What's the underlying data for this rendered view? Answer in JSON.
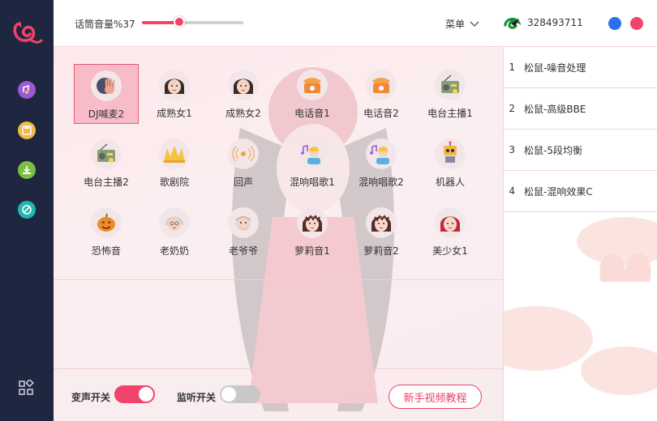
{
  "topbar": {
    "volume_label": "话筒音量%37",
    "volume_percent": 37,
    "menu_label": "菜单",
    "qq_number": "328493711",
    "window_buttons": [
      {
        "name": "minimize-dot",
        "color": "#2b6ff0"
      },
      {
        "name": "close-dot",
        "color": "#f2446a"
      }
    ]
  },
  "sidebar": {
    "items": [
      {
        "name": "sidebar-item-effects",
        "icon": "voice-icon",
        "color": "#9b59d6"
      },
      {
        "name": "sidebar-item-save",
        "icon": "disk-icon",
        "color": "#f5b64a"
      },
      {
        "name": "sidebar-item-download",
        "icon": "download-icon",
        "color": "#7bc043"
      },
      {
        "name": "sidebar-item-tools",
        "icon": "no-entry-icon",
        "color": "#22b6b0"
      }
    ],
    "bottom_icon": "grid-icon"
  },
  "effects": [
    {
      "label": "DJ喊麦2",
      "icon": "dj-hand-icon",
      "selected": true
    },
    {
      "label": "成熟女1",
      "icon": "woman-avatar-icon"
    },
    {
      "label": "成熟女2",
      "icon": "woman-avatar-icon"
    },
    {
      "label": "电话音1",
      "icon": "telephone-icon"
    },
    {
      "label": "电话音2",
      "icon": "telephone-icon"
    },
    {
      "label": "电台主播1",
      "icon": "radio-icon"
    },
    {
      "label": "电台主播2",
      "icon": "radio-icon"
    },
    {
      "label": "歌剧院",
      "icon": "opera-house-icon"
    },
    {
      "label": "回声",
      "icon": "echo-icon"
    },
    {
      "label": "混响唱歌1",
      "icon": "singer-icon"
    },
    {
      "label": "混响唱歌2",
      "icon": "singer-icon"
    },
    {
      "label": "机器人",
      "icon": "robot-icon"
    },
    {
      "label": "恐怖音",
      "icon": "pumpkin-icon"
    },
    {
      "label": "老奶奶",
      "icon": "grandma-icon"
    },
    {
      "label": "老爷爷",
      "icon": "grandpa-icon"
    },
    {
      "label": "萝莉音1",
      "icon": "girl-avatar-icon"
    },
    {
      "label": "萝莉音2",
      "icon": "girl-avatar-icon"
    },
    {
      "label": "美少女1",
      "icon": "beauty-girl-icon"
    }
  ],
  "bottom": {
    "voice_change_label": "变声开关",
    "voice_change_on": true,
    "monitor_label": "监听开关",
    "monitor_on": false,
    "tutorial_label": "新手视频教程"
  },
  "plugins": [
    {
      "num": "1",
      "name": "松鼠-噪音处理"
    },
    {
      "num": "2",
      "name": "松鼠-高级BBE"
    },
    {
      "num": "3",
      "name": "松鼠-5段均衡"
    },
    {
      "num": "4",
      "name": "松鼠-混响效果C"
    }
  ],
  "colors": {
    "accent": "#f2446a",
    "sidebar": "#1f2740",
    "selected_bg": "#f8bcc8",
    "toggle_off": "#c8c8c8"
  }
}
